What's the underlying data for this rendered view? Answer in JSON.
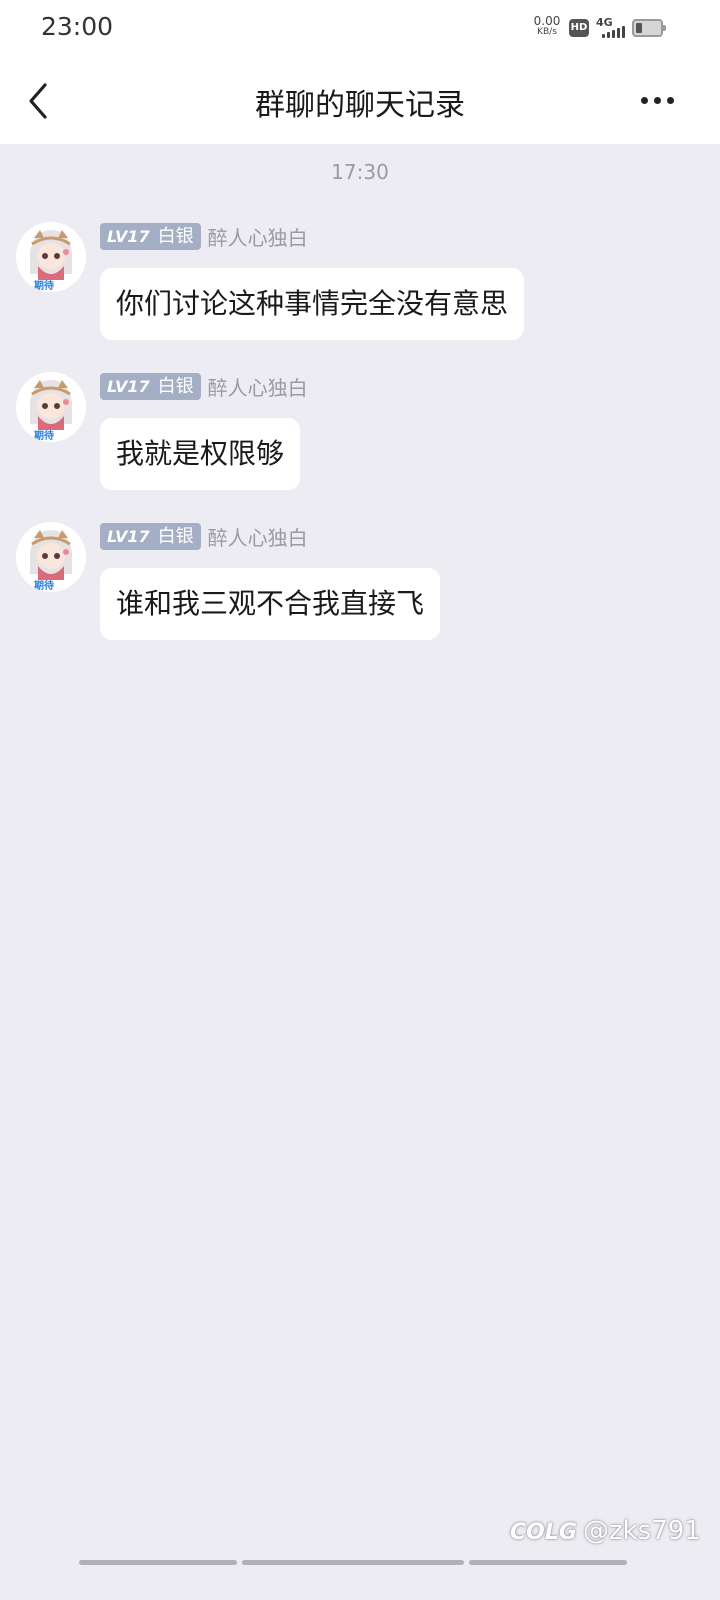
{
  "status_bar": {
    "time": "23:00",
    "net_speed_value": "0.00",
    "net_speed_unit": "KB/s",
    "hd_label": "HD",
    "network_type": "4G",
    "battery_level": 0.25,
    "icons": [
      "hd-icon",
      "signal-icon",
      "battery-icon"
    ]
  },
  "header": {
    "back_icon": "chevron-left-icon",
    "title": "群聊的聊天记录",
    "more_icon": "more-horizontal-icon"
  },
  "chat": {
    "timestamp": "17:30",
    "messages": [
      {
        "level": "LV17",
        "rank": "白银",
        "sender": "醉人心独白",
        "avatar_caption": "期待",
        "text": "你们讨论这种事情完全没有意思"
      },
      {
        "level": "LV17",
        "rank": "白银",
        "sender": "醉人心独白",
        "avatar_caption": "期待",
        "text": "我就是权限够"
      },
      {
        "level": "LV17",
        "rank": "白银",
        "sender": "醉人心独白",
        "avatar_caption": "期待",
        "text": "谁和我三观不合我直接飞"
      }
    ]
  },
  "watermark": {
    "logo": "COLG",
    "handle": "@zks791"
  },
  "colors": {
    "background": "#ececf2",
    "bubble": "#ffffff",
    "level_badge": "#a4aec4",
    "muted_text": "#9a9aa6"
  }
}
